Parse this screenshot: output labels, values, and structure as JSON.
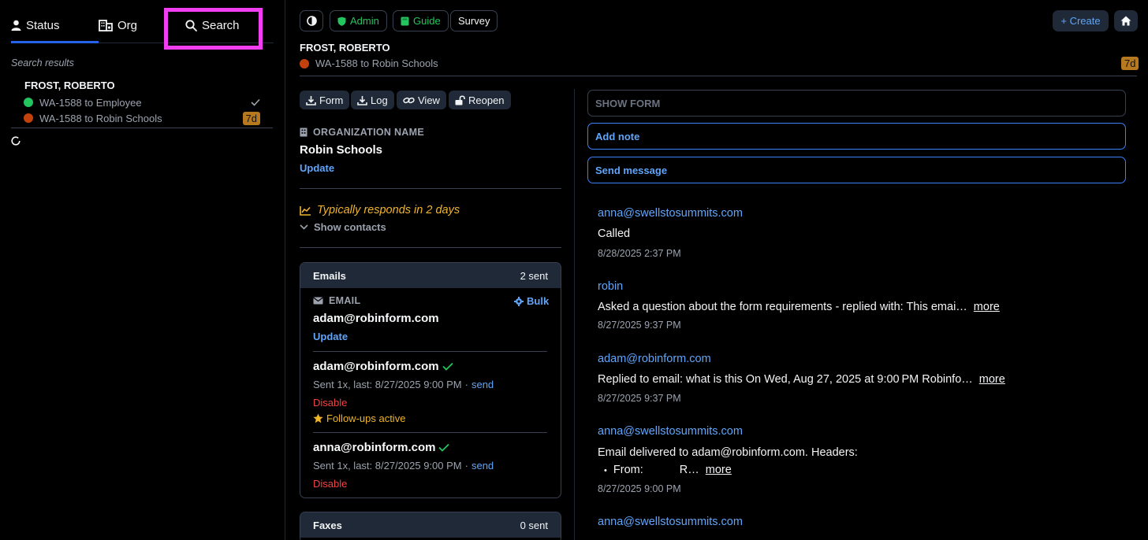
{
  "sidebar": {
    "tabs": [
      {
        "label": "Status",
        "icon": "person-icon"
      },
      {
        "label": "Org",
        "icon": "building-icon"
      },
      {
        "label": "Search",
        "icon": "search-icon"
      }
    ],
    "results_label": "Search results",
    "result": {
      "name": "FROST, ROBERTO",
      "items": [
        {
          "label": "WA-1588 to Employee",
          "dot_color": "#22c55e",
          "status": "check"
        },
        {
          "label": "WA-1588 to Robin Schools",
          "dot_color": "#c2410c",
          "badge": "7d"
        }
      ]
    }
  },
  "header": {
    "buttons": [
      {
        "label": "",
        "icon": "contrast-icon"
      },
      {
        "label": "Admin",
        "icon": "shield-icon",
        "color": "#22c55e"
      },
      {
        "label": "Guide",
        "icon": "book-icon",
        "color": "#22c55e"
      },
      {
        "label": "Survey"
      }
    ],
    "create_label": "+ Create",
    "home_icon": "home-icon",
    "person_name": "FROST, ROBERTO",
    "form_title": "WA-1588 to Robin Schools",
    "form_dot_color": "#c2410c",
    "badge": "7d"
  },
  "actions": [
    {
      "label": "Form",
      "icon": "download-icon"
    },
    {
      "label": "Log",
      "icon": "download-icon"
    },
    {
      "label": "View",
      "icon": "link-icon"
    },
    {
      "label": "Reopen",
      "icon": "unlock-icon"
    }
  ],
  "organization": {
    "section_label": "ORGANIZATION NAME",
    "name": "Robin Schools",
    "update_label": "Update"
  },
  "responsiveness": {
    "text": "Typically responds in 2 days",
    "show_contacts": "Show contacts"
  },
  "emails_card": {
    "title": "Emails",
    "count": "2 sent",
    "email_label": "EMAIL",
    "bulk_label": "Bulk",
    "primary_email": "adam@robinform.com",
    "update_label": "Update",
    "contacts": [
      {
        "email": "adam@robinform.com",
        "sent_info": "Sent 1x, last: 8/27/2025 9:00 PM",
        "send_label": "send",
        "disable_label": "Disable",
        "followups": "Follow-ups active"
      },
      {
        "email": "anna@robinform.com",
        "sent_info": "Sent 1x, last: 8/27/2025 9:00 PM",
        "send_label": "send",
        "disable_label": "Disable"
      }
    ]
  },
  "faxes_card": {
    "title": "Faxes",
    "count": "0 sent"
  },
  "right": {
    "show_form": "SHOW FORM",
    "add_note": "Add note",
    "send_message": "Send message",
    "notes": [
      {
        "author": "anna@swellstosummits.com",
        "body": "Called",
        "time": "8/28/2025 2:37 PM"
      },
      {
        "author": "robin",
        "body": "Asked a question about the form requirements - replied with: This emai…",
        "more": "more",
        "time": "8/27/2025 9:37 PM"
      },
      {
        "author": "adam@robinform.com",
        "body": "Replied to email: what is this On Wed, Aug 27, 2025 at 9:00 PM Robinfo…",
        "more": "more",
        "time": "8/27/2025 9:37 PM"
      },
      {
        "author": "anna@swellstosummits.com",
        "body": "Email delivered to adam@robinform.com. Headers:",
        "bullet": "From:",
        "bullet_tail": "R…",
        "more": "more",
        "time": "8/27/2025 9:00 PM"
      },
      {
        "author": "anna@swellstosummits.com"
      }
    ]
  }
}
